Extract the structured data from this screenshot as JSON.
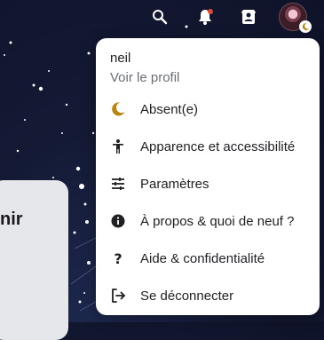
{
  "topbar": {
    "icons": [
      "search-icon",
      "bell-icon",
      "contacts-icon",
      "avatar"
    ],
    "notification_color": "#e64a2e",
    "status_color": "#b8860b"
  },
  "background_card": {
    "text": "nir"
  },
  "menu": {
    "username": "neil",
    "profile_link": "Voir le profil",
    "items": [
      {
        "label": "Absent(e)",
        "icon": "moon-icon"
      },
      {
        "label": "Apparence et accessibilité",
        "icon": "accessibility-icon"
      },
      {
        "label": "Paramètres",
        "icon": "sliders-icon"
      },
      {
        "label": "À propos & quoi de neuf ?",
        "icon": "info-icon"
      },
      {
        "label": "Aide & confidentialité",
        "icon": "question-icon"
      },
      {
        "label": "Se déconnecter",
        "icon": "logout-icon"
      }
    ]
  }
}
